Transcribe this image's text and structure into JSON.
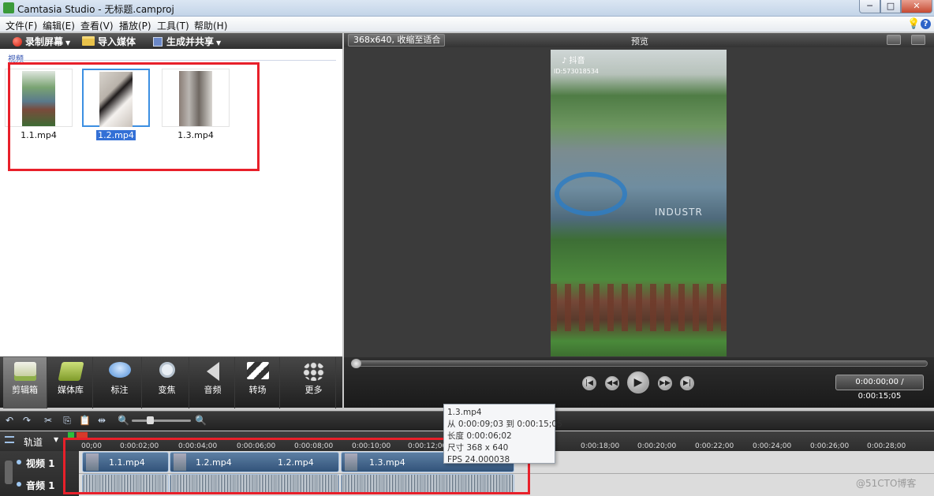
{
  "window": {
    "title": "Camtasia Studio - 无标题.camproj",
    "minimize": "─",
    "maximize": "□",
    "close": "✕"
  },
  "menu": [
    "文件(F)",
    "编辑(E)",
    "查看(V)",
    "播放(P)",
    "工具(T)",
    "帮助(H)"
  ],
  "toolbar": {
    "record": "录制屏幕",
    "import": "导入媒体",
    "produce": "生成并共享"
  },
  "clipbin": {
    "header": "视频",
    "items": [
      {
        "label": "1.1.mp4",
        "selected": false
      },
      {
        "label": "1.2.mp4",
        "selected": true
      },
      {
        "label": "1.3.mp4",
        "selected": false
      }
    ]
  },
  "tabs": [
    "剪辑箱",
    "媒体库",
    "标注",
    "变焦",
    "音频",
    "转场",
    "更多"
  ],
  "preview": {
    "zoom": "368x640, 收缩至适合",
    "title": "预览",
    "watermark_app": "♪ 抖音",
    "watermark_id": "ID:573018534",
    "sign_text": "INDUSTR",
    "timecode": "0:00:00;00 / 0:00:15;05"
  },
  "timeline": {
    "tracks_label": "轨道",
    "ticks": [
      "00;00",
      "0:00:02;00",
      "0:00:04;00",
      "0:00:06;00",
      "0:00:08;00",
      "0:00:10;00",
      "0:00:12;00",
      "0:00:18;00",
      "0:00:20;00",
      "0:00:22;00",
      "0:00:24;00",
      "0:00:26;00",
      "0:00:28;00"
    ],
    "video_track": "视频 1",
    "audio_track": "音频 1",
    "video_clips": [
      "1.1.mp4",
      "1.2.mp4",
      "1.2.mp4",
      "1.3.mp4"
    ]
  },
  "tooltip": {
    "name": "1.3.mp4",
    "range": "从 0:00:09;03 到 0:00:15;05",
    "duration": "长度 0:00:06;02",
    "size": "尺寸 368 x 640",
    "fps": "FPS 24.000038"
  },
  "site_watermark": "@51CTO博客",
  "colors": {
    "highlight_box": "#e8202a",
    "selection": "#3c8fe2",
    "clip_blue": "#4a6d94"
  }
}
